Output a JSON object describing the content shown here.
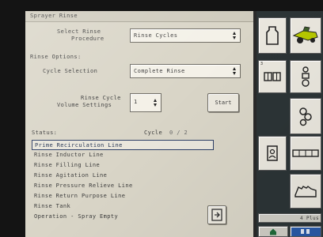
{
  "title": "Sprayer Rinse",
  "rinse_procedure": {
    "label": "Select Rinse\nProcedure",
    "value": "Rinse Cycles"
  },
  "rinse_options_heading": "Rinse Options:",
  "cycle_selection": {
    "label": "Cycle Selection",
    "value": "Complete Rinse"
  },
  "rinse_cycle": {
    "label": "Rinse Cycle\nVolume Settings",
    "value": "1"
  },
  "start_button": "Start",
  "status": {
    "label": "Status:",
    "cycle_label": "Cycle",
    "cycle_value": "0 / 2",
    "items": [
      "Prime Recirculation Line",
      "Rinse Inductor Line",
      "Rinse Filling Line",
      "Rinse Agitation Line",
      "Rinse Pressure Relieve Line",
      "Rinse Return Purpose Line",
      "Rinse Tank",
      "Operation - Spray Empty"
    ],
    "selected_index": 0
  },
  "right_panel": {
    "footer_label": "4 Plus",
    "tiles": [
      {
        "num": "",
        "icon": "tank-icon"
      },
      {
        "num": "",
        "icon": "tractor-icon"
      },
      {
        "num": "3",
        "icon": "grid-icon"
      },
      {
        "num": "",
        "icon": "nozzle-person-icon"
      },
      {
        "num": "",
        "icon": "gear-icon"
      },
      {
        "num": "",
        "icon": "product-icon"
      },
      {
        "num": "",
        "icon": "boom-icon"
      },
      {
        "num": "",
        "icon": "hand-icon"
      },
      {
        "num": "",
        "icon": "home-icon"
      },
      {
        "num": "",
        "icon": "status-icon"
      }
    ]
  }
}
